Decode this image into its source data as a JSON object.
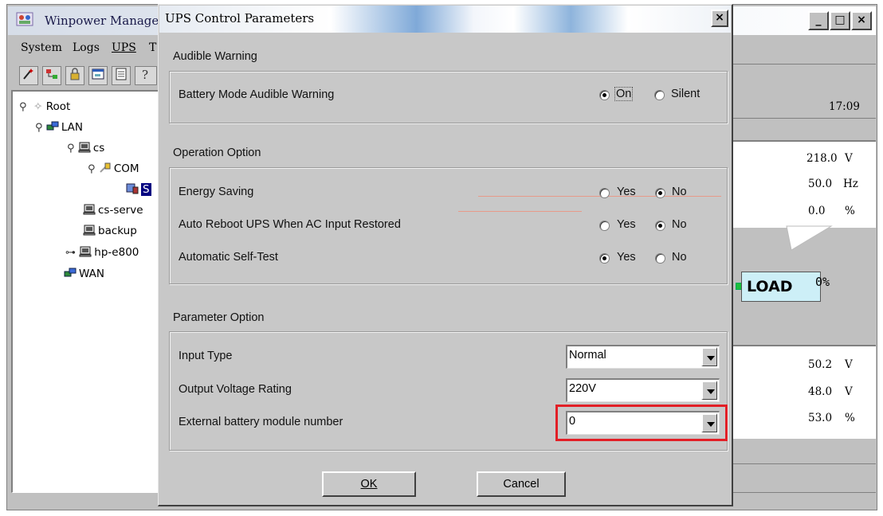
{
  "main_window": {
    "title": "Winpower Manager",
    "menus": [
      "System",
      "Logs",
      "UPS",
      "T"
    ],
    "controls": {
      "minimize": "_",
      "maximize": "□",
      "close": "×"
    }
  },
  "tree": {
    "items": [
      {
        "label": "Root",
        "icon": "root-icon"
      },
      {
        "label": "LAN",
        "icon": "network-icon"
      },
      {
        "label": "cs",
        "icon": "computer-icon"
      },
      {
        "label": "COM",
        "icon": "plug-icon"
      },
      {
        "label": "S",
        "icon": "ups-icon"
      },
      {
        "label": "cs-serve",
        "icon": "computer-icon"
      },
      {
        "label": "backup",
        "icon": "computer-icon"
      },
      {
        "label": "hp-e800",
        "icon": "computer-icon"
      },
      {
        "label": "WAN",
        "icon": "network-icon"
      }
    ]
  },
  "right_panel": {
    "time": "17:09",
    "input": [
      {
        "value": "218.0",
        "unit": "V"
      },
      {
        "value": "50.0",
        "unit": "Hz"
      },
      {
        "value": "0.0",
        "unit": "%"
      }
    ],
    "load_label": "LOAD",
    "load_value": "0%",
    "battery": [
      {
        "value": "50.2",
        "unit": "V"
      },
      {
        "value": "48.0",
        "unit": "V"
      },
      {
        "value": "53.0",
        "unit": "%"
      }
    ]
  },
  "dialog": {
    "title": "UPS Control Parameters",
    "close": "×",
    "audible_warning": {
      "label": "Audible Warning",
      "row_label": "Battery Mode Audible Warning",
      "options": [
        "On",
        "Silent"
      ],
      "selected": "On"
    },
    "operation_option": {
      "label": "Operation Option",
      "rows": [
        {
          "label": "Energy Saving",
          "options": [
            "Yes",
            "No"
          ],
          "selected": "No"
        },
        {
          "label": "Auto Reboot UPS When AC Input Restored",
          "options": [
            "Yes",
            "No"
          ],
          "selected": "No"
        },
        {
          "label": "Automatic Self-Test",
          "options": [
            "Yes",
            "No"
          ],
          "selected": "Yes"
        }
      ]
    },
    "parameter_option": {
      "label": "Parameter Option",
      "rows": [
        {
          "label": "Input Type",
          "value": "Normal"
        },
        {
          "label": "Output Voltage Rating",
          "value": "220V"
        },
        {
          "label": "External battery module number",
          "value": "0"
        }
      ]
    },
    "ok_label": "OK",
    "cancel_label": "Cancel",
    "highlight_color": "#e21f26"
  }
}
